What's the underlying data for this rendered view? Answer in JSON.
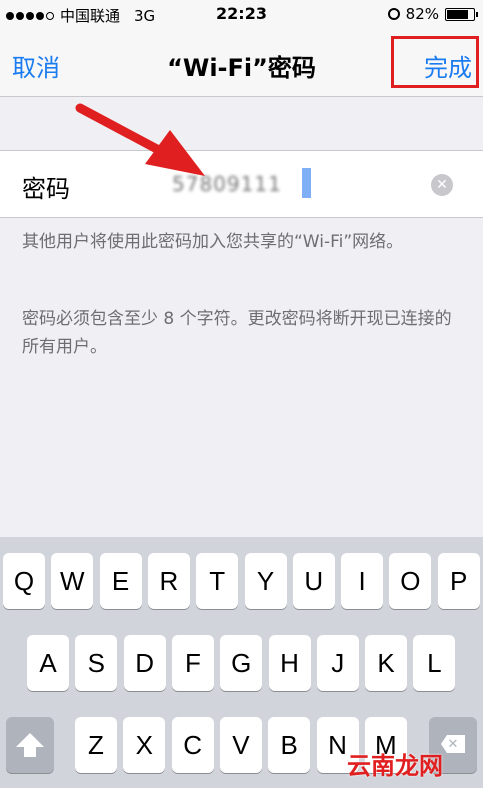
{
  "status_bar": {
    "carrier": "中国联通",
    "network": "3G",
    "time": "22:23",
    "battery": "82%",
    "battery_level": 0.82
  },
  "nav": {
    "cancel_label": "取消",
    "title": "“Wi-Fi”密码",
    "done_label": "完成"
  },
  "password_cell": {
    "label": "密码",
    "value": "57809111"
  },
  "hints": {
    "line1": "其他用户将使用此密码加入您共享的“Wi-Fi”网络。",
    "line2": "密码必须包含至少 8 个字符。更改密码将断开现已连接的所有用户。"
  },
  "keyboard": {
    "row1": [
      "Q",
      "W",
      "E",
      "R",
      "T",
      "Y",
      "U",
      "I",
      "O",
      "P"
    ],
    "row2": [
      "A",
      "S",
      "D",
      "F",
      "G",
      "H",
      "J",
      "K",
      "L"
    ],
    "row3": [
      "Z",
      "X",
      "C",
      "V",
      "B",
      "N",
      "M"
    ]
  },
  "colors": {
    "accent": "#1a7cf0",
    "highlight": "#e02020"
  },
  "watermark": "云南龙网"
}
